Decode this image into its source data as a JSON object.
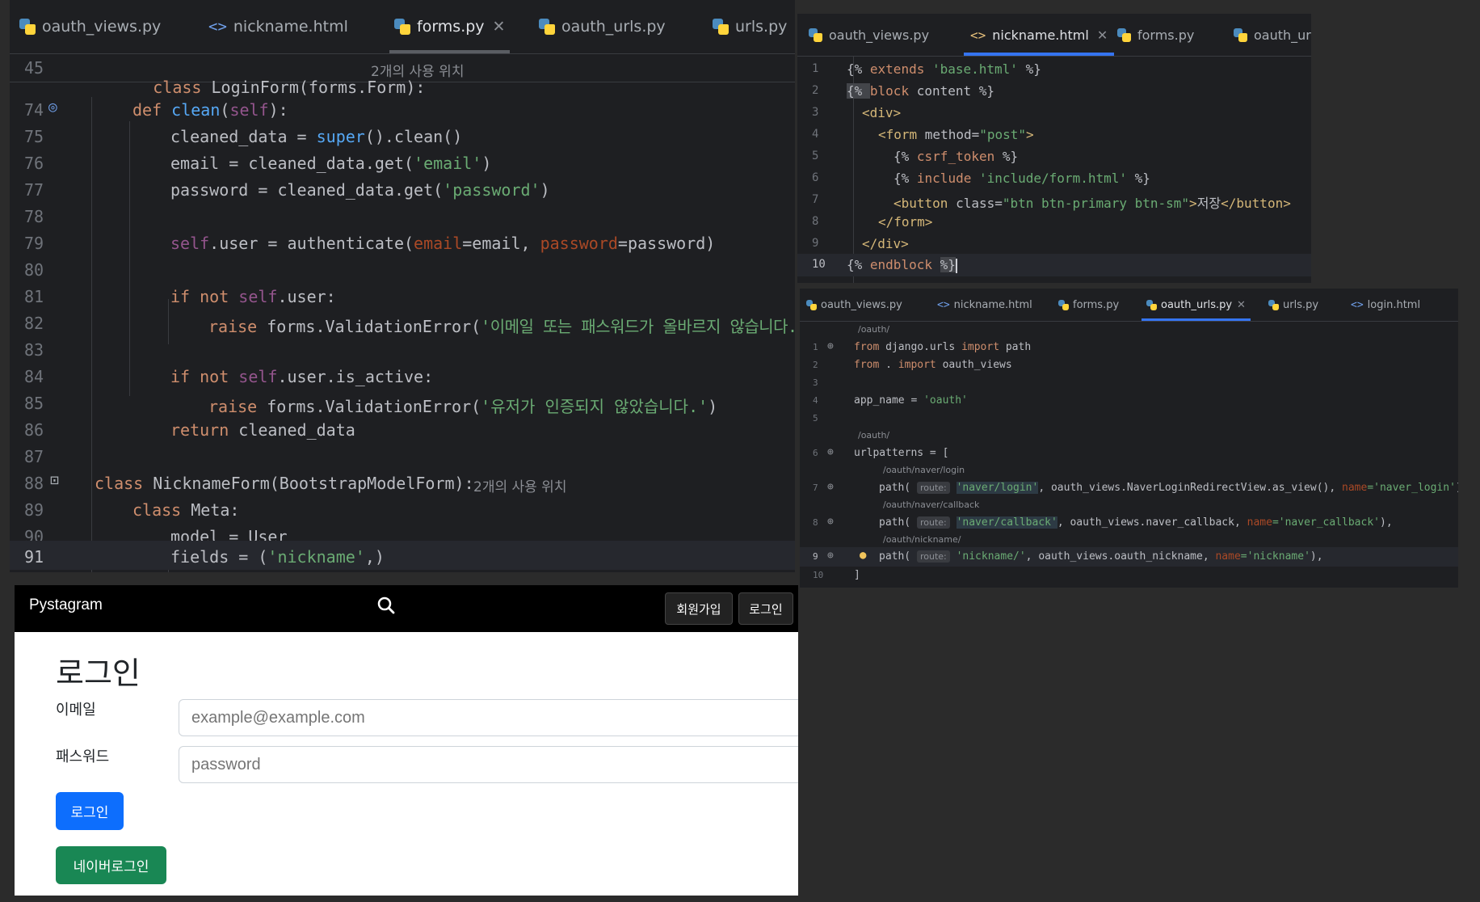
{
  "left_editor": {
    "tabs": [
      {
        "label": "oauth_views.py",
        "type": "py"
      },
      {
        "label": "nickname.html",
        "type": "html"
      },
      {
        "label": "forms.py",
        "type": "py",
        "active": true
      },
      {
        "label": "oauth_urls.py",
        "type": "py"
      },
      {
        "label": "urls.py",
        "type": "py"
      }
    ],
    "sticky_line_number": "45",
    "sticky_class": "class",
    "sticky_name": "LoginForm(forms.Form):",
    "sticky_hint": "2개의 사용 위치",
    "lines": {
      "74": "74",
      "75": "75",
      "76": "76",
      "77": "77",
      "78": "78",
      "79": "79",
      "80": "80",
      "81": "81",
      "82": "82",
      "83": "83",
      "84": "84",
      "85": "85",
      "86": "86",
      "87": "87",
      "88": "88",
      "89": "89",
      "90": "90",
      "91": "91"
    },
    "code": {
      "l74_def": "def ",
      "l74_fn": "clean",
      "l74_rest1": "(",
      "l74_self": "self",
      "l74_rest2": "):",
      "l75_a": "cleaned_data = ",
      "l75_super": "super",
      "l75_b": "().clean()",
      "l76_a": "email = cleaned_data.get(",
      "l76_s": "'email'",
      "l76_b": ")",
      "l77_a": "password = cleaned_data.get(",
      "l77_s": "'password'",
      "l77_b": ")",
      "l79_self": "self",
      "l79_a": ".user = authenticate(",
      "l79_p1": "email",
      "l79_b": "=email, ",
      "l79_p2": "password",
      "l79_c": "=password)",
      "l81_kw": "if not ",
      "l81_self": "self",
      "l81_a": ".user:",
      "l82_kw": "raise ",
      "l82_a": "forms.ValidationError(",
      "l82_s": "'이메일 또는 패스워드가 올바르지 않습니다.'",
      "l82_b": ")",
      "l84_kw": "if not ",
      "l84_self": "self",
      "l84_a": ".user.is_active:",
      "l85_kw": "raise ",
      "l85_a": "forms.ValidationError(",
      "l85_s": "'유저가 인증되지 않았습니다.'",
      "l85_b": ")",
      "l86_kw": "return ",
      "l86_a": "cleaned_data",
      "l88_kw": "class ",
      "l88_a": "NicknameForm(BootstrapModelForm):",
      "l88_hint": "2개의 사용 위치",
      "l89_kw": "class ",
      "l89_a": "Meta:",
      "l90_a": "model = User",
      "l91_a": "fields = (",
      "l91_s": "'nickname'",
      "l91_b": ",)"
    }
  },
  "nickname_editor": {
    "tabs": [
      {
        "label": "oauth_views.py",
        "type": "py"
      },
      {
        "label": "nickname.html",
        "type": "html",
        "active": true
      },
      {
        "label": "forms.py",
        "type": "py"
      },
      {
        "label": "oauth_url",
        "type": "py"
      }
    ],
    "line_numbers": [
      "1",
      "2",
      "3",
      "4",
      "5",
      "6",
      "7",
      "8",
      "9",
      "10"
    ],
    "code": {
      "l1_a": "{% ",
      "l1_kw": "extends ",
      "l1_s": "'base.html'",
      "l1_b": " %}",
      "l2_a": "{% ",
      "l2_kw": "block ",
      "l2_b": "content %}",
      "l3": "<div>",
      "l4_a": "<form ",
      "l4_attr": "method=",
      "l4_s": "\"post\"",
      "l4_b": ">",
      "l5_a": "{% ",
      "l5_kw": "csrf_token ",
      "l5_b": "%}",
      "l6_a": "{% ",
      "l6_kw": "include ",
      "l6_s": "'include/form.html'",
      "l6_b": " %}",
      "l7_a": "<button ",
      "l7_attr": "class=",
      "l7_s": "\"btn btn-primary btn-sm\"",
      "l7_b": ">",
      "l7_text": "저장",
      "l7_c": "</button>",
      "l8": "</form>",
      "l9": "</div>",
      "l10_a": "{% ",
      "l10_kw": "endblock ",
      "l10_b": "%}"
    }
  },
  "urls_editor": {
    "tabs": [
      {
        "label": "oauth_views.py",
        "type": "py"
      },
      {
        "label": "nickname.html",
        "type": "html"
      },
      {
        "label": "forms.py",
        "type": "py"
      },
      {
        "label": "oauth_urls.py",
        "type": "py",
        "active": true
      },
      {
        "label": "urls.py",
        "type": "py"
      },
      {
        "label": "login.html",
        "type": "html"
      }
    ],
    "line_numbers": [
      "1",
      "2",
      "3",
      "4",
      "5",
      "6",
      "7",
      "8",
      "9",
      "10"
    ],
    "hints": {
      "h0": "/oauth/",
      "h6": "/oauth/",
      "h7": "/oauth/naver/login",
      "h8": "/oauth/naver/callback",
      "h9": "/oauth/nickname/"
    },
    "code": {
      "l1_kw": "from ",
      "l1_a": "django.urls ",
      "l1_kw2": "import ",
      "l1_b": "path",
      "l2_kw": "from ",
      "l2_a": ". ",
      "l2_kw2": "import ",
      "l2_b": "oauth_views",
      "l4_a": "app_name = ",
      "l4_s": "'oauth'",
      "l6_a": "urlpatterns = [",
      "route": "route:",
      "l7_a": "path(",
      "l7_s": "'naver/login'",
      "l7_b": ", oauth_views.NaverLoginRedirectView.as_view(), ",
      "l7_p": "name",
      "l7_s2": "='naver_login'",
      "l7_c": "),",
      "l8_a": "path(",
      "l8_s": "'naver/callback'",
      "l8_b": ", oauth_views.naver_callback, ",
      "l8_p": "name",
      "l8_s2": "='naver_callback'",
      "l8_c": "),",
      "l9_a": "path(",
      "l9_s": "'nickname/'",
      "l9_b": ", oauth_views.oauth_nickname, ",
      "l9_p": "name",
      "l9_s2": "='nickname'",
      "l9_c": "),",
      "l10_a": "]"
    }
  },
  "browser": {
    "brand": "Pystagram",
    "signup": "회원가입",
    "login_nav": "로그인",
    "title": "로그인",
    "email_label": "이메일",
    "email_placeholder": "example@example.com",
    "password_label": "패스워드",
    "password_placeholder": "password",
    "login_button": "로그인",
    "naver_button": "네이버로그인"
  }
}
